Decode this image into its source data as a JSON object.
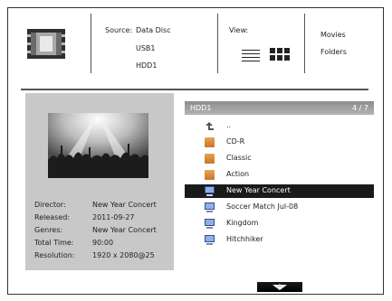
{
  "header": {
    "source_label": "Source:",
    "sources": [
      "Data Disc",
      "USB1",
      "HDD1"
    ],
    "view_label": "View:",
    "view_modes": [
      "list-view-icon",
      "grid-view-icon"
    ],
    "options": [
      "Movies",
      "Folders"
    ]
  },
  "details": {
    "rows": [
      {
        "key": "Director:",
        "value": "New Year Concert"
      },
      {
        "key": "Released:",
        "value": "2011-09-27"
      },
      {
        "key": "Genres:",
        "value": "New Year Concert"
      },
      {
        "key": "Total Time:",
        "value": "90:00"
      },
      {
        "key": "Resolution:",
        "value": "1920 x 2080@25"
      }
    ]
  },
  "browser": {
    "path": "HDD1",
    "position": "4 / 7",
    "items": [
      {
        "label": "..",
        "icon": "up-arrow-icon"
      },
      {
        "label": "CD-R",
        "icon": "folder-icon"
      },
      {
        "label": "Classic",
        "icon": "folder-icon"
      },
      {
        "label": "Action",
        "icon": "folder-icon"
      },
      {
        "label": "New Year Concert",
        "icon": "video-file-icon",
        "selected": true
      },
      {
        "label": "Soccer Match Jul-08",
        "icon": "video-file-icon"
      },
      {
        "label": "Kingdom",
        "icon": "video-file-icon"
      },
      {
        "label": "Hitchhiker",
        "icon": "video-file-icon"
      }
    ]
  },
  "colors": {
    "selected_row": "#1a1a1a",
    "panel": "#c8c8c8",
    "folder": "#d98a3c"
  }
}
